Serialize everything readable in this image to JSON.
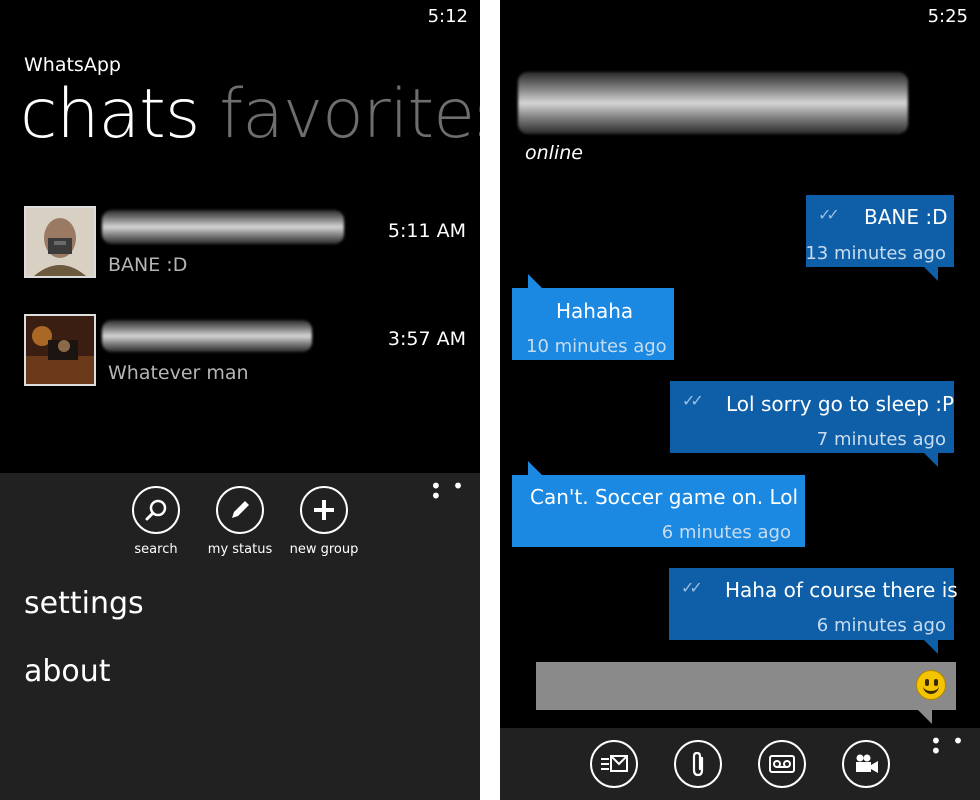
{
  "left_screen": {
    "clock": "5:12",
    "app_title": "WhatsApp",
    "pivot": {
      "active": "chats",
      "inactive": "favorites"
    },
    "chats": [
      {
        "time": "5:11 AM",
        "snippet": "BANE :D"
      },
      {
        "time": "3:57 AM",
        "snippet": "Whatever man"
      }
    ],
    "appbar": {
      "buttons": [
        {
          "icon": "search-icon",
          "label": "search"
        },
        {
          "icon": "pencil-icon",
          "label": "my status"
        },
        {
          "icon": "plus-icon",
          "label": "new group"
        }
      ],
      "more": "• • •",
      "menu": [
        "settings",
        "about"
      ]
    }
  },
  "right_screen": {
    "clock": "5:25",
    "status": "online",
    "messages": [
      {
        "direction": "out",
        "text": "BANE :D",
        "time": "13 minutes ago"
      },
      {
        "direction": "in",
        "text": "Hahaha",
        "time": "10 minutes ago"
      },
      {
        "direction": "out",
        "text": "Lol sorry go to sleep :P",
        "time": "7 minutes ago"
      },
      {
        "direction": "in",
        "text": "Can't. Soccer game on. Lol",
        "time": "6 minutes ago"
      },
      {
        "direction": "out",
        "text": "Haha of course there is",
        "time": "6 minutes ago"
      }
    ],
    "delivered_mark": "✓✓",
    "appbar": {
      "buttons": [
        "send-mail-icon",
        "paperclip-icon",
        "voicemail-icon",
        "video-camera-icon"
      ],
      "more": "• • •"
    }
  },
  "colors": {
    "background": "#000000",
    "appbar": "#212121",
    "bubble_out": "#0e5fa8",
    "bubble_in": "#1b88e2",
    "inactive_pivot": "#6e6e6e"
  }
}
